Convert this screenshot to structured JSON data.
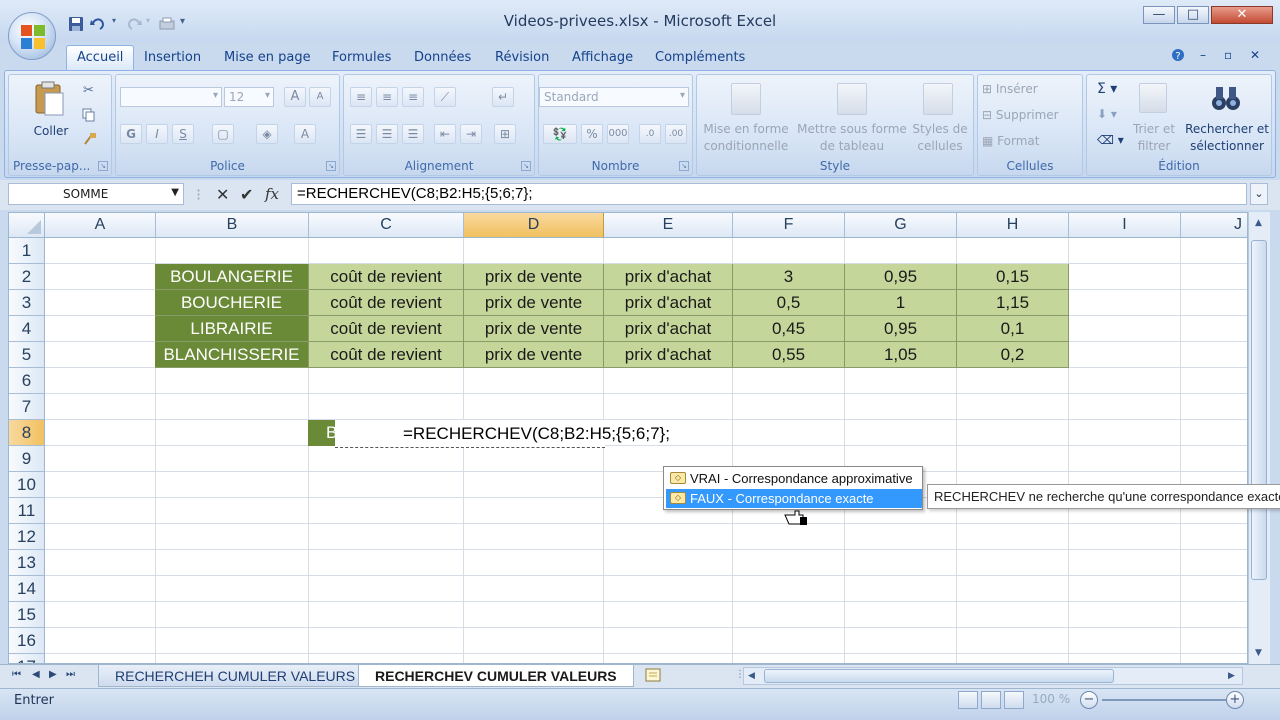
{
  "window": {
    "title": "Videos-privees.xlsx - Microsoft Excel",
    "minimize": "—",
    "maximize": "□",
    "close": "✕"
  },
  "tabs": [
    "Accueil",
    "Insertion",
    "Mise en page",
    "Formules",
    "Données",
    "Révision",
    "Affichage",
    "Compléments"
  ],
  "ribbon": {
    "clipboard": {
      "paste": "Coller",
      "label": "Presse-pap..."
    },
    "font": {
      "size": "12",
      "bold": "G",
      "italic": "I",
      "underline": "S",
      "grow": "A",
      "shrink": "A",
      "label": "Police"
    },
    "alignment": {
      "label": "Alignement"
    },
    "number": {
      "format": "Standard",
      "percent": "%",
      "thousands": "000",
      "label": "Nombre"
    },
    "style": {
      "conditional": [
        "Mise en forme",
        "conditionnelle"
      ],
      "table": [
        "Mettre sous forme",
        "de tableau"
      ],
      "cellstyles": [
        "Styles de",
        "cellules"
      ],
      "label": "Style"
    },
    "cells": {
      "insert": "Insérer",
      "delete": "Supprimer",
      "format": "Format",
      "label": "Cellules"
    },
    "editing": {
      "sort": [
        "Trier et",
        "filtrer"
      ],
      "find": [
        "Rechercher et",
        "sélectionner"
      ],
      "label": "Édition"
    }
  },
  "formula_bar": {
    "name_box": "SOMME",
    "formula": "=RECHERCHEV(C8;B2:H5;{5;6;7};"
  },
  "columns": [
    "A",
    "B",
    "C",
    "D",
    "E",
    "F",
    "G",
    "H",
    "I",
    "J"
  ],
  "rows": [
    "1",
    "2",
    "3",
    "4",
    "5",
    "6",
    "7",
    "8",
    "9",
    "10",
    "11",
    "12",
    "13",
    "14",
    "15",
    "16",
    "17"
  ],
  "table": [
    [
      "BOULANGERIE",
      "coût de revient",
      "prix de vente",
      "prix d'achat",
      "3",
      "0,95",
      "0,15"
    ],
    [
      "BOUCHERIE",
      "coût de revient",
      "prix de vente",
      "prix d'achat",
      "0,5",
      "1",
      "1,15"
    ],
    [
      "LIBRAIRIE",
      "coût de revient",
      "prix de vente",
      "prix d'achat",
      "0,45",
      "0,95",
      "0,1"
    ],
    [
      "BLANCHISSERIE",
      "coût de revient",
      "prix de vente",
      "prix d'achat",
      "0,55",
      "1,05",
      "0,2"
    ]
  ],
  "edit_cell": {
    "b8_partial": "B",
    "text": "=RECHERCHEV(C8;B2:H5;{5;6;7};"
  },
  "autocomplete": {
    "items": [
      "VRAI - Correspondance approximative",
      "FAUX - Correspondance exacte"
    ],
    "selected_index": 1,
    "tooltip": "RECHERCHEV ne recherche qu'une correspondance exacte"
  },
  "sheets": {
    "tabs": [
      "RECHERCHEH CUMULER VALEURS",
      "RECHERCHEV CUMULER VALEURS"
    ],
    "active_index": 1
  },
  "status": {
    "mode": "Entrer",
    "zoom": "100 %"
  },
  "colors": {
    "header_dark_green": "#6b8a38",
    "light_green": "#c5d69a",
    "selected_header": "#f1c15f",
    "ribbon_blue": "#d2e1f4",
    "autocomplete_selected": "#3399ff"
  }
}
